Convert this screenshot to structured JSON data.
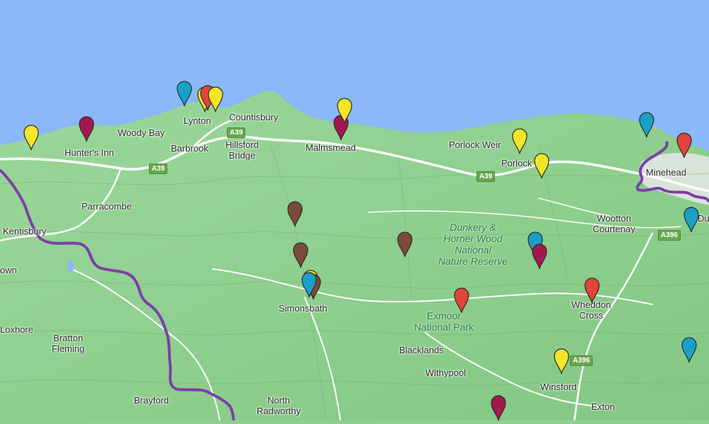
{
  "map": {
    "colors": {
      "sea": "#8ab8f8",
      "land": "#8fd08f",
      "road": "#ffffff",
      "boundary": "#7d3fa8",
      "town": "#e6e6e6"
    },
    "places": [
      {
        "id": "hunters-inn",
        "label": "Hunter's Inn"
      },
      {
        "id": "woody-bay",
        "label": "Woody Bay"
      },
      {
        "id": "lynton",
        "label": "Lynton"
      },
      {
        "id": "countisbury",
        "label": "Countisbury"
      },
      {
        "id": "barbrook",
        "label": "Barbrook"
      },
      {
        "id": "hillsford-bridge",
        "label": "Hillsford\nBridge"
      },
      {
        "id": "malmsmead",
        "label": "Malmsmead"
      },
      {
        "id": "porlock-weir",
        "label": "Porlock Weir"
      },
      {
        "id": "porlock",
        "label": "Porlock"
      },
      {
        "id": "minehead",
        "label": "Minehead"
      },
      {
        "id": "parracombe",
        "label": "Parracombe"
      },
      {
        "id": "kentisbury",
        "label": "Kentisbury"
      },
      {
        "id": "wootton-courtenay",
        "label": "Wootton\nCourtenay"
      },
      {
        "id": "du",
        "label": "Du"
      },
      {
        "id": "own",
        "label": "own"
      },
      {
        "id": "simonsbath",
        "label": "Simonsbath"
      },
      {
        "id": "wheddon-cross",
        "label": "Wheddon\nCross"
      },
      {
        "id": "loxhore",
        "label": "Loxhore"
      },
      {
        "id": "bratton-fleming",
        "label": "Bratton\nFleming"
      },
      {
        "id": "blacklands",
        "label": "Blacklands"
      },
      {
        "id": "withypool",
        "label": "Withypool"
      },
      {
        "id": "winsford",
        "label": "Winsford"
      },
      {
        "id": "brayford",
        "label": "Brayford"
      },
      {
        "id": "north-radworthy",
        "label": "North\nRadworthy"
      },
      {
        "id": "exton",
        "label": "Exton"
      }
    ],
    "parks": [
      {
        "id": "dunkery",
        "label": "Dunkery &\nHorner Wood\nNational\nNature Reserve"
      },
      {
        "id": "exmoor",
        "label": "Exmoor\nNational Park"
      }
    ],
    "roads": [
      {
        "id": "a39-west",
        "label": "A39"
      },
      {
        "id": "a39-lynton",
        "label": "A39"
      },
      {
        "id": "a39-east",
        "label": "A39"
      },
      {
        "id": "a396-north",
        "label": "A396"
      },
      {
        "id": "a396-south",
        "label": "A396"
      }
    ],
    "markers": [
      {
        "color": "yellow"
      },
      {
        "color": "maroon"
      },
      {
        "color": "blue"
      },
      {
        "color": "yellow"
      },
      {
        "color": "red"
      },
      {
        "color": "yellow"
      },
      {
        "color": "maroon"
      },
      {
        "color": "yellow"
      },
      {
        "color": "yellow"
      },
      {
        "color": "yellow"
      },
      {
        "color": "blue"
      },
      {
        "color": "red"
      },
      {
        "color": "blue"
      },
      {
        "color": "brown"
      },
      {
        "color": "brown"
      },
      {
        "color": "brown"
      },
      {
        "color": "blue"
      },
      {
        "color": "yellow"
      },
      {
        "color": "brown"
      },
      {
        "color": "blue"
      },
      {
        "color": "maroon"
      },
      {
        "color": "red"
      },
      {
        "color": "red"
      },
      {
        "color": "blue"
      },
      {
        "color": "yellow"
      },
      {
        "color": "maroon"
      }
    ],
    "marker_colors": {
      "yellow": "#f4e526",
      "red": "#e0443a",
      "blue": "#1aa0c8",
      "maroon": "#a3194f",
      "brown": "#7a4a3a"
    }
  }
}
